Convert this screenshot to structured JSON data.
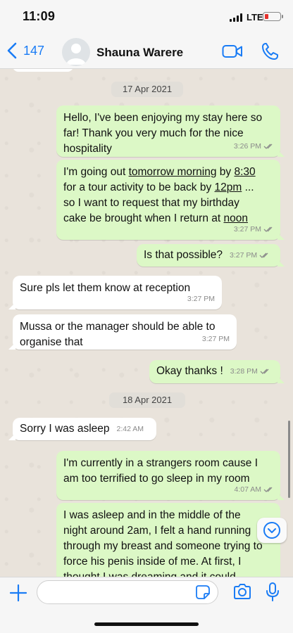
{
  "status_bar": {
    "time": "11:09",
    "network": "LTE",
    "battery_color": "#e5322d"
  },
  "header": {
    "back_count": "147",
    "contact_name": "Shauna Warere",
    "accent_color": "#1a7cf5",
    "icons": [
      "chevron-left-icon",
      "avatar",
      "video-call-icon",
      "phone-icon"
    ]
  },
  "chat": {
    "dates": [
      "17 Apr 2021",
      "18 Apr 2021"
    ],
    "messages": [
      {
        "direction": "outgoing",
        "lines": [
          "Hello, I've been enjoying my stay here so",
          "far! Thank you very much for the nice",
          "hospitality"
        ],
        "time": "3:26 PM",
        "read": true
      },
      {
        "direction": "outgoing",
        "segments": [
          [
            "I'm going out ",
            "tomorrow morning",
            " by ",
            "8:30"
          ],
          [
            "for a tour activity to be back by ",
            "12pm",
            " ..."
          ],
          [
            "so I want to request that my birthday"
          ],
          [
            "cake be  brought when I return at ",
            "noon"
          ]
        ],
        "time": "3:27 PM",
        "read": true
      },
      {
        "direction": "outgoing",
        "text": "Is that possible?",
        "time": "3:27 PM",
        "read": true
      },
      {
        "direction": "incoming",
        "text": "Sure pls let them know at reception",
        "time": "3:27 PM"
      },
      {
        "direction": "incoming",
        "lines": [
          "Mussa or the manager should be able to",
          "organise that"
        ],
        "time": "3:27 PM"
      },
      {
        "direction": "outgoing",
        "text": "Okay thanks !",
        "time": "3:28 PM",
        "read": true
      },
      {
        "direction": "incoming",
        "text": "Sorry I was asleep",
        "time": "2:42 AM"
      },
      {
        "direction": "outgoing",
        "lines": [
          "I'm currently in a strangers room cause I",
          "am too terrified to go sleep in my room"
        ],
        "time": "4:07 AM",
        "read": true
      },
      {
        "direction": "outgoing",
        "lines": [
          "I was asleep and in the middle of the",
          "night around 2am, I felt a hand running",
          "through my breast and someone trying to",
          "force his penis inside of me. At first, I",
          "thought I was dreaming and it could"
        ]
      }
    ]
  },
  "input_bar": {
    "placeholder": "",
    "value": ""
  },
  "colors": {
    "outgoing_bubble": "#dcf8c6",
    "incoming_bubble": "#ffffff",
    "read_ticks": "#8b8b8b",
    "chat_background": "#e9e3db"
  }
}
